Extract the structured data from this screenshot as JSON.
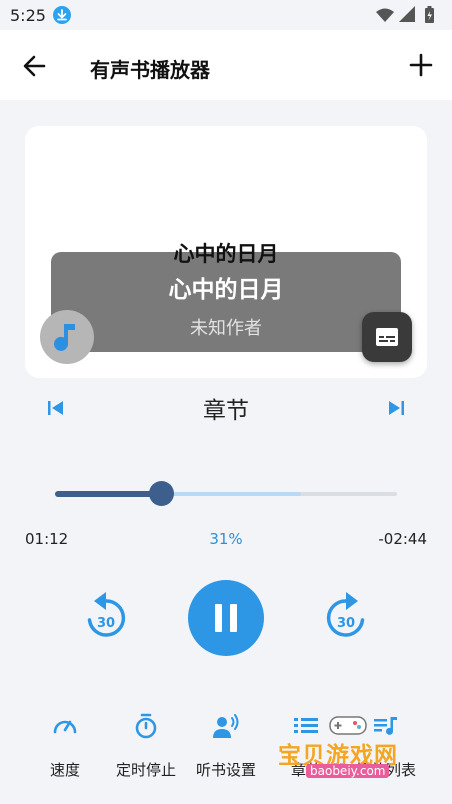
{
  "status_bar": {
    "time": "5:25"
  },
  "app_bar": {
    "title": "有声书播放器"
  },
  "now_playing": {
    "book_title_top": "心中的日月",
    "book_title": "心中的日月",
    "author": "未知作者"
  },
  "chapter": {
    "title": "章节"
  },
  "progress": {
    "elapsed": "01:12",
    "percent": "31%",
    "remaining": "-02:44",
    "fraction": 0.31,
    "buffered_fraction": 0.72
  },
  "controls": {
    "rewind_seconds": "30",
    "forward_seconds": "30"
  },
  "bottom_bar": {
    "items": [
      {
        "label": "速度",
        "icon": "speedometer-icon"
      },
      {
        "label": "定时停止",
        "icon": "stopwatch-icon"
      },
      {
        "label": "听书设置",
        "icon": "voice-settings-icon"
      },
      {
        "label": "章节",
        "icon": "chapter-list-icon"
      },
      {
        "label": "播放列表",
        "icon": "playlist-icon"
      }
    ]
  },
  "watermark": {
    "text": "宝贝游戏网",
    "url": "baobeiy.com"
  },
  "colors": {
    "accent": "#2d97e6",
    "progress": "#3d5f8e",
    "buffer": "#b9d9f4"
  }
}
